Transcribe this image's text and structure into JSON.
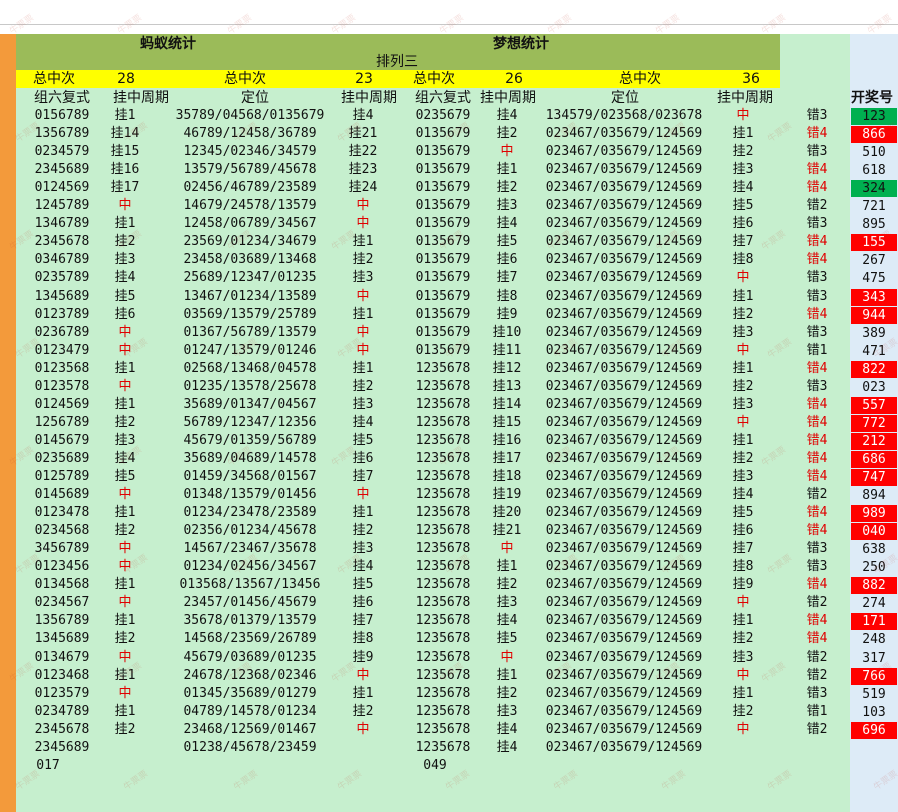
{
  "headers": {
    "left_title": "蚂蚁统计",
    "right_title": "梦想统计",
    "subtitle": "排列三",
    "yellow": [
      "总中次",
      "28",
      "总中次",
      "23",
      "总中次",
      "26",
      "总中次",
      "36"
    ],
    "columns": [
      "组六复式",
      "挂中周期",
      "定位",
      "挂中周期",
      "组六复式",
      "挂中周期",
      "定位",
      "挂中周期"
    ],
    "result_header": "开奖号"
  },
  "rows": [
    {
      "z1": "0156789",
      "p1": "挂1",
      "d1": "35789/04568/0135679",
      "p2": "挂4",
      "z2": "0235679",
      "p3": "挂4",
      "d2": "134579/023568/023678",
      "p4": "中",
      "e": "错3",
      "r": "123"
    },
    {
      "z1": "1356789",
      "p1": "挂14",
      "d1": "46789/12458/36789",
      "p2": "挂21",
      "z2": "0135679",
      "p3": "挂2",
      "d2": "023467/035679/124569",
      "p4": "挂1",
      "e": "错4",
      "r": "866"
    },
    {
      "z1": "0234579",
      "p1": "挂15",
      "d1": "12345/02346/34579",
      "p2": "挂22",
      "z2": "0135679",
      "p3": "中",
      "d2": "023467/035679/124569",
      "p4": "挂2",
      "e": "错3",
      "r": "510"
    },
    {
      "z1": "2345689",
      "p1": "挂16",
      "d1": "13579/56789/45678",
      "p2": "挂23",
      "z2": "0135679",
      "p3": "挂1",
      "d2": "023467/035679/124569",
      "p4": "挂3",
      "e": "错4",
      "r": "618"
    },
    {
      "z1": "0124569",
      "p1": "挂17",
      "d1": "02456/46789/23589",
      "p2": "挂24",
      "z2": "0135679",
      "p3": "挂2",
      "d2": "023467/035679/124569",
      "p4": "挂4",
      "e": "错4",
      "r": "324"
    },
    {
      "z1": "1245789",
      "p1": "中",
      "d1": "14679/24578/13579",
      "p2": "中",
      "z2": "0135679",
      "p3": "挂3",
      "d2": "023467/035679/124569",
      "p4": "挂5",
      "e": "错2",
      "r": "721"
    },
    {
      "z1": "1346789",
      "p1": "挂1",
      "d1": "12458/06789/34567",
      "p2": "中",
      "z2": "0135679",
      "p3": "挂4",
      "d2": "023467/035679/124569",
      "p4": "挂6",
      "e": "错3",
      "r": "895"
    },
    {
      "z1": "2345678",
      "p1": "挂2",
      "d1": "23569/01234/34679",
      "p2": "挂1",
      "z2": "0135679",
      "p3": "挂5",
      "d2": "023467/035679/124569",
      "p4": "挂7",
      "e": "错4",
      "r": "155"
    },
    {
      "z1": "0346789",
      "p1": "挂3",
      "d1": "23458/03689/13468",
      "p2": "挂2",
      "z2": "0135679",
      "p3": "挂6",
      "d2": "023467/035679/124569",
      "p4": "挂8",
      "e": "错4",
      "r": "267"
    },
    {
      "z1": "0235789",
      "p1": "挂4",
      "d1": "25689/12347/01235",
      "p2": "挂3",
      "z2": "0135679",
      "p3": "挂7",
      "d2": "023467/035679/124569",
      "p4": "中",
      "e": "错3",
      "r": "475"
    },
    {
      "z1": "1345689",
      "p1": "挂5",
      "d1": "13467/01234/13589",
      "p2": "中",
      "z2": "0135679",
      "p3": "挂8",
      "d2": "023467/035679/124569",
      "p4": "挂1",
      "e": "错3",
      "r": "343"
    },
    {
      "z1": "0123789",
      "p1": "挂6",
      "d1": "03569/13579/25789",
      "p2": "挂1",
      "z2": "0135679",
      "p3": "挂9",
      "d2": "023467/035679/124569",
      "p4": "挂2",
      "e": "错4",
      "r": "944"
    },
    {
      "z1": "0236789",
      "p1": "中",
      "d1": "01367/56789/13579",
      "p2": "中",
      "z2": "0135679",
      "p3": "挂10",
      "d2": "023467/035679/124569",
      "p4": "挂3",
      "e": "错3",
      "r": "389"
    },
    {
      "z1": "0123479",
      "p1": "中",
      "d1": "01247/13579/01246",
      "p2": "中",
      "z2": "0135679",
      "p3": "挂11",
      "d2": "023467/035679/124569",
      "p4": "中",
      "e": "错1",
      "r": "471"
    },
    {
      "z1": "0123568",
      "p1": "挂1",
      "d1": "02568/13468/04578",
      "p2": "挂1",
      "z2": "1235678",
      "p3": "挂12",
      "d2": "023467/035679/124569",
      "p4": "挂1",
      "e": "错4",
      "r": "822"
    },
    {
      "z1": "0123578",
      "p1": "中",
      "d1": "01235/13578/25678",
      "p2": "挂2",
      "z2": "1235678",
      "p3": "挂13",
      "d2": "023467/035679/124569",
      "p4": "挂2",
      "e": "错3",
      "r": "023"
    },
    {
      "z1": "0124569",
      "p1": "挂1",
      "d1": "35689/01347/04567",
      "p2": "挂3",
      "z2": "1235678",
      "p3": "挂14",
      "d2": "023467/035679/124569",
      "p4": "挂3",
      "e": "错4",
      "r": "557"
    },
    {
      "z1": "1256789",
      "p1": "挂2",
      "d1": "56789/12347/12356",
      "p2": "挂4",
      "z2": "1235678",
      "p3": "挂15",
      "d2": "023467/035679/124569",
      "p4": "中",
      "e": "错4",
      "r": "772"
    },
    {
      "z1": "0145679",
      "p1": "挂3",
      "d1": "45679/01359/56789",
      "p2": "挂5",
      "z2": "1235678",
      "p3": "挂16",
      "d2": "023467/035679/124569",
      "p4": "挂1",
      "e": "错4",
      "r": "212"
    },
    {
      "z1": "0235689",
      "p1": "挂4",
      "d1": "35689/04689/14578",
      "p2": "挂6",
      "z2": "1235678",
      "p3": "挂17",
      "d2": "023467/035679/124569",
      "p4": "挂2",
      "e": "错4",
      "r": "686"
    },
    {
      "z1": "0125789",
      "p1": "挂5",
      "d1": "01459/34568/01567",
      "p2": "挂7",
      "z2": "1235678",
      "p3": "挂18",
      "d2": "023467/035679/124569",
      "p4": "挂3",
      "e": "错4",
      "r": "747"
    },
    {
      "z1": "0145689",
      "p1": "中",
      "d1": "01348/13579/01456",
      "p2": "中",
      "z2": "1235678",
      "p3": "挂19",
      "d2": "023467/035679/124569",
      "p4": "挂4",
      "e": "错2",
      "r": "894"
    },
    {
      "z1": "0123478",
      "p1": "挂1",
      "d1": "01234/23478/23589",
      "p2": "挂1",
      "z2": "1235678",
      "p3": "挂20",
      "d2": "023467/035679/124569",
      "p4": "挂5",
      "e": "错4",
      "r": "989"
    },
    {
      "z1": "0234568",
      "p1": "挂2",
      "d1": "02356/01234/45678",
      "p2": "挂2",
      "z2": "1235678",
      "p3": "挂21",
      "d2": "023467/035679/124569",
      "p4": "挂6",
      "e": "错4",
      "r": "040"
    },
    {
      "z1": "3456789",
      "p1": "中",
      "d1": "14567/23467/35678",
      "p2": "挂3",
      "z2": "1235678",
      "p3": "中",
      "d2": "023467/035679/124569",
      "p4": "挂7",
      "e": "错3",
      "r": "638"
    },
    {
      "z1": "0123456",
      "p1": "中",
      "d1": "01234/02456/34567",
      "p2": "挂4",
      "z2": "1235678",
      "p3": "挂1",
      "d2": "023467/035679/124569",
      "p4": "挂8",
      "e": "错3",
      "r": "250"
    },
    {
      "z1": "0134568",
      "p1": "挂1",
      "d1": "013568/13567/13456",
      "p2": "挂5",
      "z2": "1235678",
      "p3": "挂2",
      "d2": "023467/035679/124569",
      "p4": "挂9",
      "e": "错4",
      "r": "882"
    },
    {
      "z1": "0234567",
      "p1": "中",
      "d1": "23457/01456/45679",
      "p2": "挂6",
      "z2": "1235678",
      "p3": "挂3",
      "d2": "023467/035679/124569",
      "p4": "中",
      "e": "错2",
      "r": "274"
    },
    {
      "z1": "1356789",
      "p1": "挂1",
      "d1": "35678/01379/13579",
      "p2": "挂7",
      "z2": "1235678",
      "p3": "挂4",
      "d2": "023467/035679/124569",
      "p4": "挂1",
      "e": "错4",
      "r": "171"
    },
    {
      "z1": "1345689",
      "p1": "挂2",
      "d1": "14568/23569/26789",
      "p2": "挂8",
      "z2": "1235678",
      "p3": "挂5",
      "d2": "023467/035679/124569",
      "p4": "挂2",
      "e": "错4",
      "r": "248"
    },
    {
      "z1": "0134679",
      "p1": "中",
      "d1": "45679/03689/01235",
      "p2": "挂9",
      "z2": "1235678",
      "p3": "中",
      "d2": "023467/035679/124569",
      "p4": "挂3",
      "e": "错2",
      "r": "317"
    },
    {
      "z1": "0123468",
      "p1": "挂1",
      "d1": "24678/12368/02346",
      "p2": "中",
      "z2": "1235678",
      "p3": "挂1",
      "d2": "023467/035679/124569",
      "p4": "中",
      "e": "错2",
      "r": "766"
    },
    {
      "z1": "0123579",
      "p1": "中",
      "d1": "01345/35689/01279",
      "p2": "挂1",
      "z2": "1235678",
      "p3": "挂2",
      "d2": "023467/035679/124569",
      "p4": "挂1",
      "e": "错3",
      "r": "519"
    },
    {
      "z1": "0234789",
      "p1": "挂1",
      "d1": "04789/14578/01234",
      "p2": "挂2",
      "z2": "1235678",
      "p3": "挂3",
      "d2": "023467/035679/124569",
      "p4": "挂2",
      "e": "错1",
      "r": "103"
    },
    {
      "z1": "2345678",
      "p1": "挂2",
      "d1": "23468/12569/01467",
      "p2": "中",
      "z2": "1235678",
      "p3": "挂4",
      "d2": "023467/035679/124569",
      "p4": "中",
      "e": "错2",
      "r": "696"
    },
    {
      "z1": "2345689",
      "p1": "",
      "d1": "01238/45678/23459",
      "p2": "",
      "z2": "1235678",
      "p3": "挂4",
      "d2": "023467/035679/124569",
      "p4": "",
      "e": "",
      "r": ""
    }
  ],
  "footer": {
    "left": "017",
    "right": "049"
  },
  "colors": {
    "hit": "#e00000",
    "bg": "#c6efce",
    "header_green": "#9bbb59",
    "header_yellow": "#ffff00",
    "result_red": "#ff0000",
    "result_green": "#00b050",
    "result_blue": "#ddebf7"
  },
  "result_styles": {
    "123": "green",
    "866": "red",
    "324": "green",
    "155": "red",
    "343": "red",
    "944": "red",
    "822": "red",
    "557": "red",
    "772": "red",
    "212": "red",
    "686": "red",
    "747": "red",
    "989": "red",
    "040": "red",
    "882": "red",
    "171": "red",
    "766": "red",
    "696": "red"
  },
  "error_red_values": [
    "错4"
  ],
  "watermark_text": "牛票票"
}
